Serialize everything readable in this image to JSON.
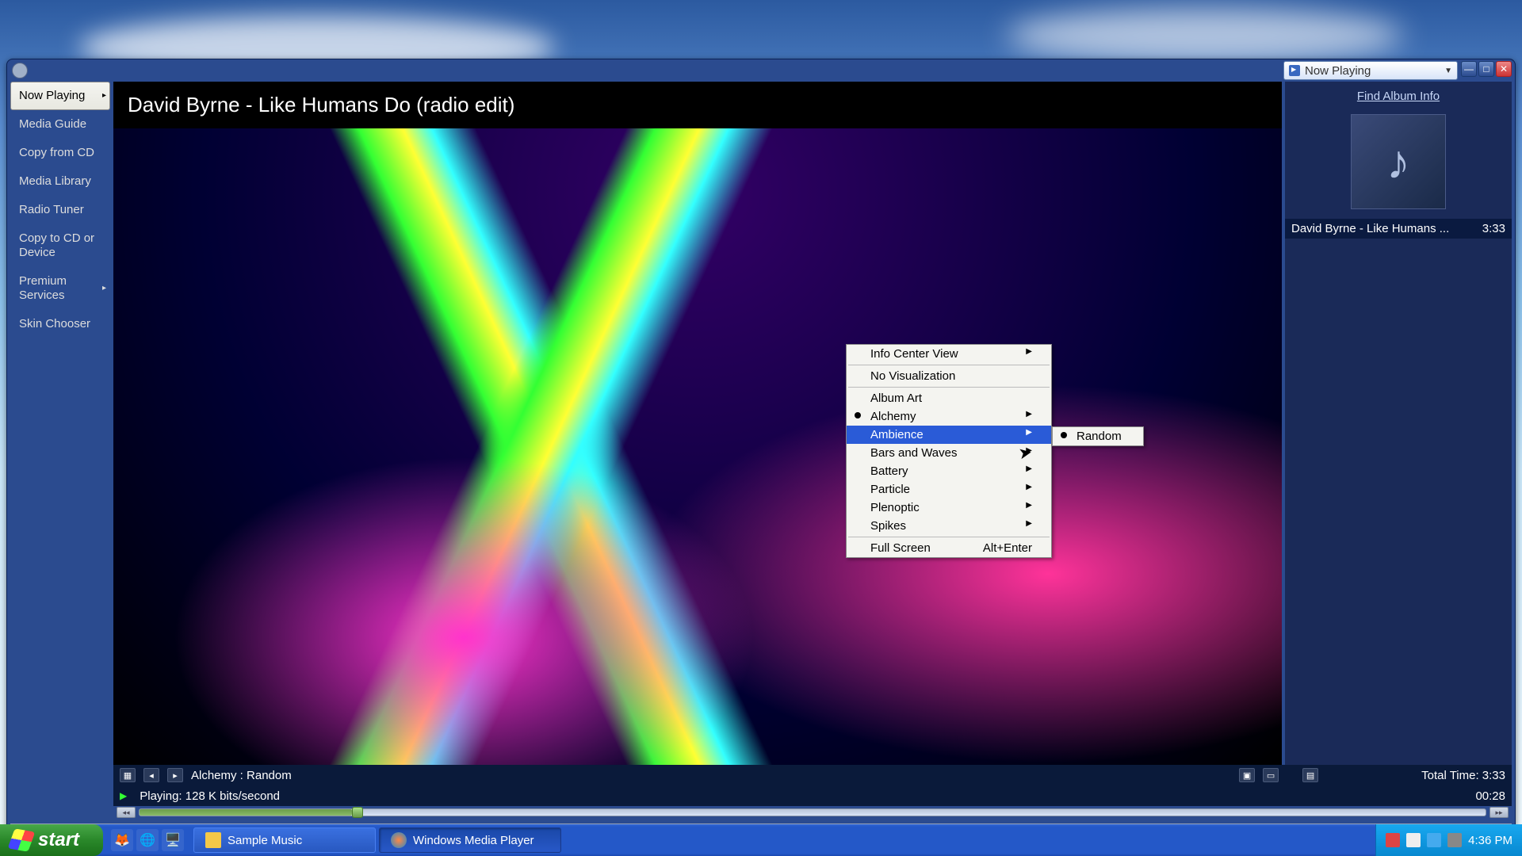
{
  "header": {
    "dropdown_label": "Now Playing"
  },
  "sidebar": {
    "items": [
      {
        "label": "Now Playing",
        "active": true,
        "arrow": true
      },
      {
        "label": "Media Guide"
      },
      {
        "label": "Copy from CD"
      },
      {
        "label": "Media Library"
      },
      {
        "label": "Radio Tuner"
      },
      {
        "label": "Copy to CD or Device"
      },
      {
        "label": "Premium Services",
        "arrow": true
      },
      {
        "label": "Skin Chooser"
      }
    ]
  },
  "track": {
    "title": "David Byrne - Like Humans Do (radio edit)"
  },
  "album_panel": {
    "find_info": "Find Album Info",
    "playlist_title": "David Byrne - Like Humans ...",
    "playlist_duration": "3:33"
  },
  "status": {
    "viz_name": "Alchemy : Random",
    "total_time_label": "Total Time: 3:33",
    "playing_label": "Playing: 128 K bits/second",
    "elapsed": "00:28"
  },
  "context_menu": {
    "items": [
      {
        "label": "Info Center View",
        "arrow": true
      },
      {
        "sep": true
      },
      {
        "label": "No Visualization"
      },
      {
        "sep": true
      },
      {
        "label": "Album Art"
      },
      {
        "label": "Alchemy",
        "arrow": true,
        "bullet": true
      },
      {
        "label": "Ambience",
        "arrow": true,
        "highlighted": true
      },
      {
        "label": "Bars and Waves",
        "arrow": true
      },
      {
        "label": "Battery",
        "arrow": true
      },
      {
        "label": "Particle",
        "arrow": true
      },
      {
        "label": "Plenoptic",
        "arrow": true
      },
      {
        "label": "Spikes",
        "arrow": true
      },
      {
        "sep": true
      },
      {
        "label": "Full Screen",
        "shortcut": "Alt+Enter"
      }
    ],
    "submenu": [
      {
        "label": "Random",
        "bullet": true
      }
    ]
  },
  "taskbar": {
    "start": "start",
    "items": [
      {
        "label": "Sample Music"
      },
      {
        "label": "Windows Media Player",
        "active": true
      }
    ],
    "clock": "4:36 PM"
  }
}
